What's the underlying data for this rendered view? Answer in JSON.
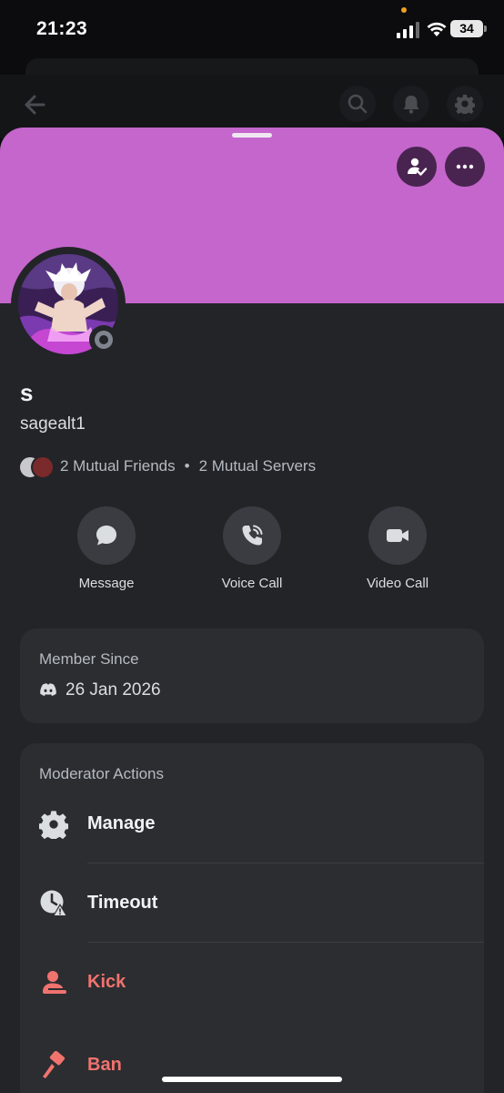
{
  "status_bar": {
    "time": "21:23",
    "battery": "34"
  },
  "profile": {
    "display_name": "s",
    "username": "sagealt1",
    "mutual_friends": "2 Mutual Friends",
    "mutual_separator": "•",
    "mutual_servers": "2 Mutual Servers",
    "banner_color": "#c466cc"
  },
  "actions": [
    {
      "label": "Message",
      "icon": "chat-bubble-icon"
    },
    {
      "label": "Voice Call",
      "icon": "phone-icon"
    },
    {
      "label": "Video Call",
      "icon": "video-camera-icon"
    }
  ],
  "member_since": {
    "title": "Member Since",
    "date": "26 Jan 2026"
  },
  "moderator": {
    "title": "Moderator Actions",
    "items": [
      {
        "label": "Manage",
        "icon": "gear-icon",
        "color": "#f2f3f5"
      },
      {
        "label": "Timeout",
        "icon": "clock-warning-icon",
        "color": "#f2f3f5"
      },
      {
        "label": "Kick",
        "icon": "user-kick-icon",
        "color": "#f0736e"
      },
      {
        "label": "Ban",
        "icon": "hammer-icon",
        "color": "#f0736e"
      }
    ]
  },
  "colors": {
    "sheet": "#232428",
    "card": "#2b2d31",
    "danger": "#f0736e",
    "accent_button": "#4a2450"
  }
}
